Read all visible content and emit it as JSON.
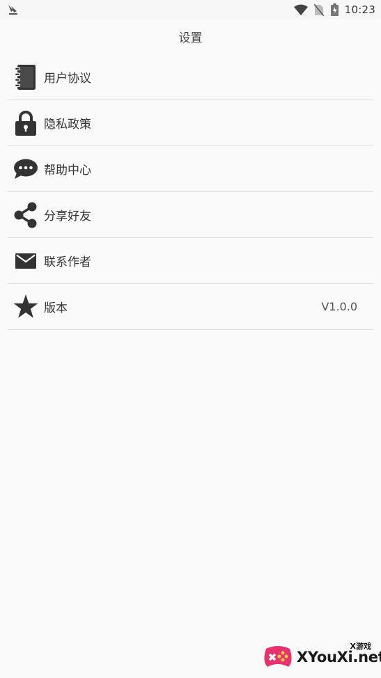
{
  "status_bar": {
    "time": "10:23"
  },
  "header": {
    "title": "设置"
  },
  "menu": {
    "items": [
      {
        "label": "用户协议",
        "icon": "notebook-icon"
      },
      {
        "label": "隐私政策",
        "icon": "lock-icon"
      },
      {
        "label": "帮助中心",
        "icon": "chat-bubble-icon"
      },
      {
        "label": "分享好友",
        "icon": "share-icon"
      },
      {
        "label": "联系作者",
        "icon": "mail-icon"
      },
      {
        "label": "版本",
        "icon": "star-icon",
        "value": "V1.0.0"
      }
    ]
  },
  "watermark": {
    "small_text": "X游戏",
    "text": "XYouXi.net"
  },
  "colors": {
    "background": "#fafafa",
    "icon": "#333333",
    "divider": "#dcdcdc"
  }
}
